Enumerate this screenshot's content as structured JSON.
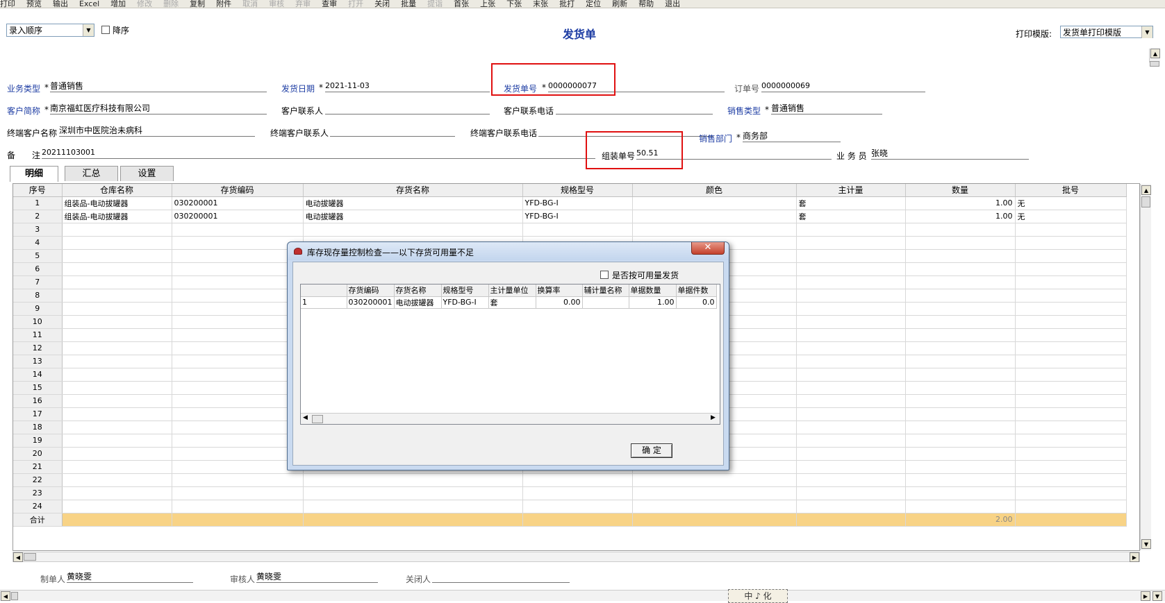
{
  "toolbar": {
    "items": [
      {
        "label": "打印",
        "disabled": false
      },
      {
        "label": "预览",
        "disabled": false
      },
      {
        "label": "输出",
        "disabled": false
      },
      {
        "label": "Excel",
        "disabled": false
      },
      {
        "label": "增加",
        "disabled": false
      },
      {
        "label": "修改",
        "disabled": true
      },
      {
        "label": "删除",
        "disabled": true
      },
      {
        "label": "复制",
        "disabled": false
      },
      {
        "label": "附件",
        "disabled": false
      },
      {
        "label": "取消",
        "disabled": true
      },
      {
        "label": "审核",
        "disabled": true
      },
      {
        "label": "弃审",
        "disabled": true
      },
      {
        "label": "查审",
        "disabled": false
      },
      {
        "label": "打开",
        "disabled": true
      },
      {
        "label": "关闭",
        "disabled": false
      },
      {
        "label": "批量",
        "disabled": false
      },
      {
        "label": "提诣",
        "disabled": true
      },
      {
        "label": "首张",
        "disabled": false
      },
      {
        "label": "上张",
        "disabled": false
      },
      {
        "label": "下张",
        "disabled": false
      },
      {
        "label": "末张",
        "disabled": false
      },
      {
        "label": "批打",
        "disabled": false
      },
      {
        "label": "定位",
        "disabled": false
      },
      {
        "label": "刷新",
        "disabled": false
      },
      {
        "label": "帮助",
        "disabled": false
      },
      {
        "label": "退出",
        "disabled": false
      }
    ]
  },
  "sort": {
    "value": "录入顺序",
    "desc_label": "降序"
  },
  "page_title": "发货单",
  "print_template": {
    "label": "打印模版:",
    "value": "发货单打印模版"
  },
  "header": {
    "biz_type": {
      "label": "业务类型",
      "value": "普通销售"
    },
    "ship_date": {
      "label": "发货日期",
      "value": "2021-11-03"
    },
    "ship_no": {
      "label": "发货单号",
      "value": "0000000077"
    },
    "order_no": {
      "label": "订单号",
      "value": "0000000069"
    },
    "customer": {
      "label": "客户简称",
      "value": "南京福虹医疗科技有限公司"
    },
    "contact": {
      "label": "客户联系人",
      "value": ""
    },
    "contact_phone": {
      "label": "客户联系电话",
      "value": ""
    },
    "sale_type": {
      "label": "销售类型",
      "value": "普通销售"
    },
    "end_customer": {
      "label": "终端客户名称",
      "value": "深圳市中医院治未病科"
    },
    "end_contact": {
      "label": "终端客户联系人",
      "value": ""
    },
    "end_phone": {
      "label": "终端客户联系电话",
      "value": ""
    },
    "dept": {
      "label": "销售部门",
      "value": "商务部"
    },
    "remark_a": "备",
    "remark_b": "注",
    "remark": {
      "value": "20211103001"
    },
    "assembly_no": {
      "label": "组装单号",
      "value": "50.51"
    },
    "salesman": {
      "label": "业 务 员",
      "value": "张晓"
    },
    "required_mark": "*"
  },
  "tabs": [
    "明细",
    "汇总",
    "设置"
  ],
  "grid": {
    "columns": [
      "序号",
      "仓库名称",
      "存货编码",
      "存货名称",
      "规格型号",
      "颜色",
      "主计量",
      "数量",
      "批号"
    ],
    "rows": [
      [
        "1",
        "组装品-电动拔罐器",
        "030200001",
        "电动拔罐器",
        "YFD-BG-I",
        "",
        "套",
        "1.00",
        "无"
      ],
      [
        "2",
        "组装品-电动拔罐器",
        "030200001",
        "电动拔罐器",
        "YFD-BG-I",
        "",
        "套",
        "1.00",
        "无"
      ],
      [
        "3",
        "",
        "",
        "",
        "",
        "",
        "",
        "",
        ""
      ],
      [
        "4",
        "",
        "",
        "",
        "",
        "",
        "",
        "",
        ""
      ],
      [
        "5",
        "",
        "",
        "",
        "",
        "",
        "",
        "",
        ""
      ],
      [
        "6",
        "",
        "",
        "",
        "",
        "",
        "",
        "",
        ""
      ],
      [
        "7",
        "",
        "",
        "",
        "",
        "",
        "",
        "",
        ""
      ],
      [
        "8",
        "",
        "",
        "",
        "",
        "",
        "",
        "",
        ""
      ],
      [
        "9",
        "",
        "",
        "",
        "",
        "",
        "",
        "",
        ""
      ],
      [
        "10",
        "",
        "",
        "",
        "",
        "",
        "",
        "",
        ""
      ],
      [
        "11",
        "",
        "",
        "",
        "",
        "",
        "",
        "",
        ""
      ],
      [
        "12",
        "",
        "",
        "",
        "",
        "",
        "",
        "",
        ""
      ],
      [
        "13",
        "",
        "",
        "",
        "",
        "",
        "",
        "",
        ""
      ],
      [
        "14",
        "",
        "",
        "",
        "",
        "",
        "",
        "",
        ""
      ],
      [
        "15",
        "",
        "",
        "",
        "",
        "",
        "",
        "",
        ""
      ],
      [
        "16",
        "",
        "",
        "",
        "",
        "",
        "",
        "",
        ""
      ],
      [
        "17",
        "",
        "",
        "",
        "",
        "",
        "",
        "",
        ""
      ],
      [
        "18",
        "",
        "",
        "",
        "",
        "",
        "",
        "",
        ""
      ],
      [
        "19",
        "",
        "",
        "",
        "",
        "",
        "",
        "",
        ""
      ],
      [
        "20",
        "",
        "",
        "",
        "",
        "",
        "",
        "",
        ""
      ],
      [
        "21",
        "",
        "",
        "",
        "",
        "",
        "",
        "",
        ""
      ],
      [
        "22",
        "",
        "",
        "",
        "",
        "",
        "",
        "",
        ""
      ],
      [
        "23",
        "",
        "",
        "",
        "",
        "",
        "",
        "",
        ""
      ],
      [
        "24",
        "",
        "",
        "",
        "",
        "",
        "",
        "",
        ""
      ]
    ],
    "total_label": "合计",
    "total_qty": "2.00",
    "total_color": "#f8d386"
  },
  "footer": {
    "maker": {
      "label": "制单人",
      "value": "黄晓雯"
    },
    "auditor": {
      "label": "审核人",
      "value": "黄晓雯"
    },
    "closer": {
      "label": "关闭人",
      "value": ""
    }
  },
  "ime": "中 ♪ 化",
  "dialog": {
    "title": "库存现存量控制检查——以下存货可用量不足",
    "close_glyph": "✕",
    "checkbox_label": "是否按可用量发货",
    "columns": [
      "",
      "存货编码",
      "存货名称",
      "规格型号",
      "主计量单位",
      "换算率",
      "辅计量名称",
      "单据数量",
      "单据件数"
    ],
    "rows": [
      [
        "1",
        "030200001",
        "电动拔罐器",
        "YFD-BG-I",
        "套",
        "0.00",
        "",
        "1.00",
        "0.0"
      ]
    ],
    "ok_label": "确 定"
  },
  "colors": {
    "accent_red": "#e01010",
    "label_blue": "#1d3ca3"
  }
}
